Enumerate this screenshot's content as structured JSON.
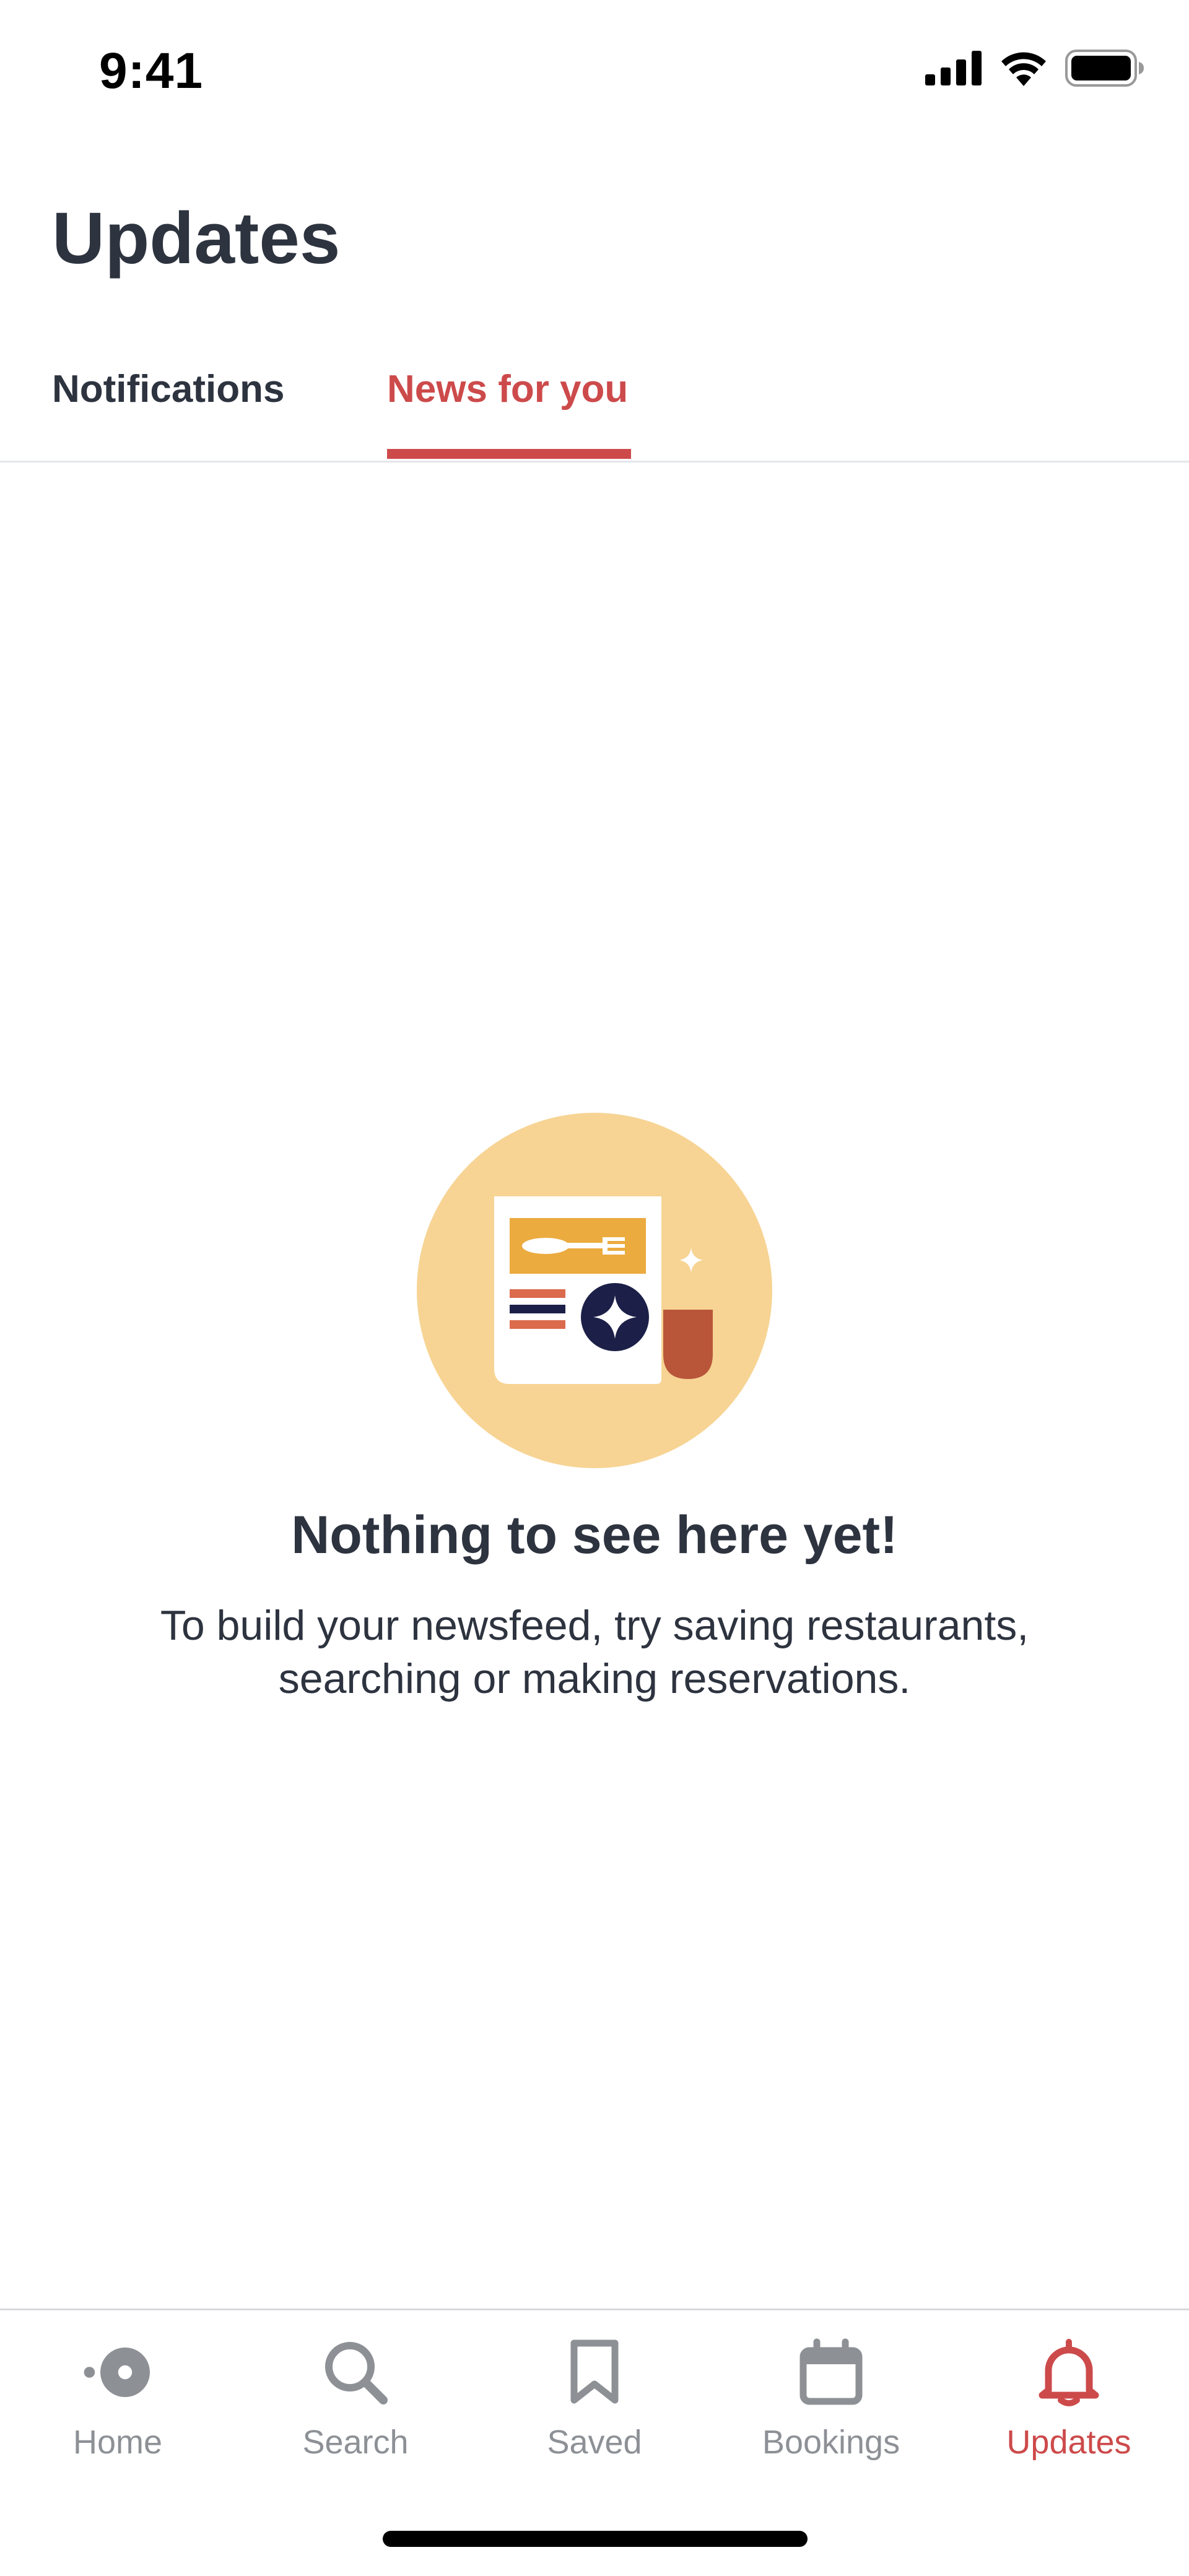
{
  "status_bar": {
    "time": "9:41",
    "icons": [
      "signal-icon",
      "wifi-icon",
      "battery-icon"
    ]
  },
  "header": {
    "title": "Updates"
  },
  "tabs": [
    {
      "label": "Notifications",
      "active": false
    },
    {
      "label": "News for you",
      "active": true
    }
  ],
  "empty_state": {
    "illustration": "newspaper-illustration",
    "title": "Nothing to see here yet!",
    "message": "To build your newsfeed, try saving restaurants, searching or making reservations."
  },
  "bottom_nav": [
    {
      "label": "Home",
      "icon": "home-icon",
      "active": false
    },
    {
      "label": "Search",
      "icon": "search-icon",
      "active": false
    },
    {
      "label": "Saved",
      "icon": "bookmark-icon",
      "active": false
    },
    {
      "label": "Bookings",
      "icon": "calendar-icon",
      "active": false
    },
    {
      "label": "Updates",
      "icon": "bell-icon",
      "active": true
    }
  ],
  "colors": {
    "accent": "#cd4a4b",
    "text": "#2d333f",
    "inactive": "#8d9196",
    "illustration_bg": "#f7d494"
  }
}
